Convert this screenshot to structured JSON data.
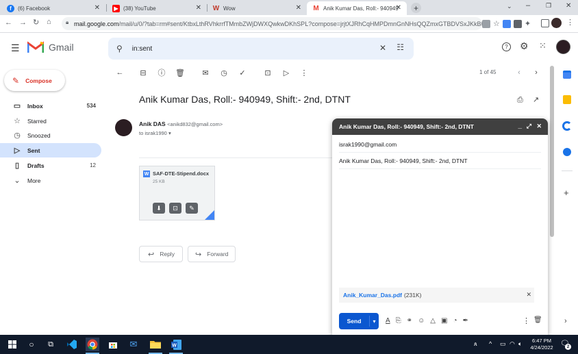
{
  "browser": {
    "tabs": [
      {
        "title": "(6) Facebook",
        "icon": "facebook-icon",
        "color": "#1877f2"
      },
      {
        "title": "(38) YouTube",
        "icon": "youtube-icon",
        "color": "#ff0000"
      },
      {
        "title": "Wow",
        "icon": "word-w-icon",
        "color": "#c0392b"
      },
      {
        "title": "Anik Kumar Das, Roll:- 940949, S",
        "icon": "gmail-icon",
        "color": "#ea4335"
      }
    ],
    "url_host": "mail.google.com",
    "url_path": "/mail/u/0/?tab=rm#sent/KtbxLthRVhkrrfTMmbZWjDWXQwkwDKhSPL?compose=jrjtXJRhCqHMPDmnGnNHsQQZmxGTBDVSxJKkBBrrm..."
  },
  "gmail": {
    "logo_text": "Gmail",
    "search_value": "in:sent",
    "compose_label": "Compose",
    "nav": [
      {
        "label": "Inbox",
        "count": "534",
        "icon": "inbox-icon"
      },
      {
        "label": "Starred",
        "count": "",
        "icon": "star-icon"
      },
      {
        "label": "Snoozed",
        "count": "",
        "icon": "clock-icon"
      },
      {
        "label": "Sent",
        "count": "",
        "icon": "send-icon"
      },
      {
        "label": "Drafts",
        "count": "12",
        "icon": "draft-icon"
      },
      {
        "label": "More",
        "count": "",
        "icon": "chevron-down-icon"
      }
    ],
    "pagination": "1 of 45"
  },
  "message": {
    "subject": "Anik Kumar Das, Roll:- 940949, Shift:- 2nd, DTNT",
    "sender_name": "Anik DAS",
    "sender_email": "<anikd832@gmail.com>",
    "to_line": "to israk1990",
    "attachment_name": "SAF-DTE-Stipend.docx",
    "attachment_size": "25 KB",
    "reply_label": "Reply",
    "forward_label": "Forward"
  },
  "compose_window": {
    "title": "Anik Kumar Das, Roll:- 940949, Shift:- 2nd, DTNT",
    "to": "israk1990@gmail.com",
    "subject": "Anik Kumar Das, Roll:- 940949, Shift:- 2nd, DTNT",
    "attachment_name": "Anik_Kumar_Das.pdf",
    "attachment_size": "(231K)",
    "send_label": "Send"
  },
  "taskbar": {
    "time": "6:47 PM",
    "date": "4/24/2022",
    "notification_count": "2"
  }
}
